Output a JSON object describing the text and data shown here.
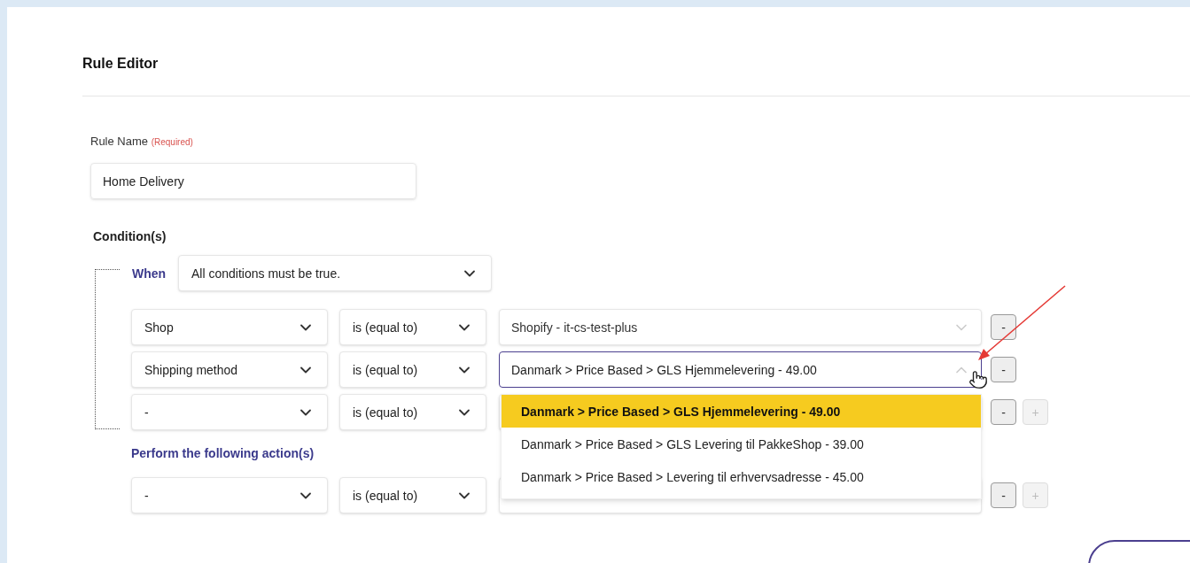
{
  "title": "Rule Editor",
  "rule_name": {
    "label": "Rule Name",
    "required": "(Required)",
    "value": "Home Delivery"
  },
  "conditions": {
    "heading": "Condition(s)",
    "when_label": "When",
    "when_value": "All conditions must be true.",
    "rows": [
      {
        "field": "Shop",
        "operator": "is (equal to)",
        "value": "Shopify - it-cs-test-plus",
        "disabled": true,
        "expanded": false,
        "remove": "-"
      },
      {
        "field": "Shipping method",
        "operator": "is (equal to)",
        "value": "Danmark > Price Based > GLS Hjemmelevering - 49.00",
        "disabled": false,
        "expanded": true,
        "remove": "-",
        "options": [
          {
            "label": "Danmark > Price Based > GLS Hjemmelevering - 49.00",
            "selected": true
          },
          {
            "label": "Danmark > Price Based > GLS Levering til PakkeShop - 39.00",
            "selected": false
          },
          {
            "label": "Danmark > Price Based > Levering til erhvervsadresse - 45.00",
            "selected": false
          }
        ]
      },
      {
        "field": "-",
        "operator": "is (equal to)",
        "remove": "-",
        "add": "+",
        "add_disabled": true
      }
    ]
  },
  "actions": {
    "heading": "Perform the following action(s)",
    "rows": [
      {
        "field": "-",
        "operator": "is (equal to)",
        "remove": "-",
        "add": "+",
        "add_disabled": true
      }
    ]
  }
}
